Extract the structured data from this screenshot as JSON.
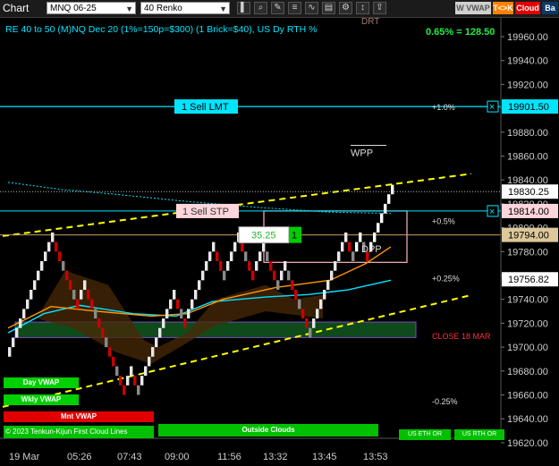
{
  "toolbar": {
    "title": "Chart",
    "instrument": "MNQ 06-25",
    "bar_type": "40 Renko",
    "buttons": [
      {
        "name": "bar-type-button",
        "glyph": "▌"
      },
      {
        "name": "zoom-button",
        "glyph": "⌕"
      },
      {
        "name": "drawing-button",
        "glyph": "✎"
      },
      {
        "name": "strategy-button",
        "glyph": "≡"
      },
      {
        "name": "indicator-button",
        "glyph": "∿"
      },
      {
        "name": "data-button",
        "glyph": "▤"
      },
      {
        "name": "settings-button",
        "glyph": "⚙"
      },
      {
        "name": "vertical-button",
        "glyph": "↕"
      },
      {
        "name": "share-button",
        "glyph": "⇪"
      }
    ],
    "wvwap_label": "W VWAP",
    "tk_label": "T<>K",
    "cloud_label": "Cloud",
    "extra_label": "Ba"
  },
  "header": {
    "info": "RE 40 to 50 (M)NQ Dec 20 (1%=150p=$300) (1 Brick=$40), US Dy RTH %",
    "perf": "0.65% = 128.50",
    "drt": "DRT"
  },
  "colors": {
    "bg": "#000000",
    "bull": "#ffffff",
    "bear": "#cc0000",
    "cyan": "#00e5ff",
    "orange": "#ff9900",
    "yellow": "#ffff00",
    "green": "#00cc00",
    "pink": "#ffb6c1"
  },
  "orders": {
    "sell_lmt": {
      "label": "1 Sell LMT",
      "price": "19901.50"
    },
    "sell_stp": {
      "label": "1 Sell STP",
      "price": "19814.00"
    },
    "position": {
      "pnl": "35.25",
      "qty": "1",
      "price": "19794.00"
    }
  },
  "levels": {
    "current_price": "19830.25",
    "vwap_price": "19756.82",
    "wpp": "WPP",
    "dpp": "DPP",
    "pct_labels": [
      {
        "text": "+1.0%",
        "price": 19901.5
      },
      {
        "text": "+0.5%",
        "price": 19806
      },
      {
        "text": "+0.25%",
        "price": 19758
      },
      {
        "text": "-0.25%",
        "price": 19655
      }
    ],
    "close_label": "CLOSE 18 MAR",
    "close_price": 19710
  },
  "chart_data": {
    "type": "renko",
    "brick_size": 8,
    "ylim": [
      19612,
      19980
    ],
    "y_ticks": [
      19620,
      19640,
      19660,
      19680,
      19700,
      19720,
      19740,
      19760,
      19780,
      19800,
      19820,
      19840,
      19860,
      19880,
      19900,
      19920,
      19940,
      19960
    ],
    "x_labels": [
      "19 Mar",
      "05:26",
      "07:43",
      "09:00",
      "11:56",
      "13:32",
      "13:45",
      "13:53"
    ],
    "bricks": [
      {
        "open": 19692,
        "dir": "up"
      },
      {
        "open": 19700,
        "dir": "up"
      },
      {
        "open": 19708,
        "dir": "up"
      },
      {
        "open": 19716,
        "dir": "up"
      },
      {
        "open": 19724,
        "dir": "up"
      },
      {
        "open": 19732,
        "dir": "up"
      },
      {
        "open": 19740,
        "dir": "up"
      },
      {
        "open": 19748,
        "dir": "up"
      },
      {
        "open": 19756,
        "dir": "up"
      },
      {
        "open": 19764,
        "dir": "up"
      },
      {
        "open": 19772,
        "dir": "up"
      },
      {
        "open": 19780,
        "dir": "up"
      },
      {
        "open": 19788,
        "dir": "up"
      },
      {
        "open": 19788,
        "dir": "down"
      },
      {
        "open": 19780,
        "dir": "down"
      },
      {
        "open": 19772,
        "dir": "down"
      },
      {
        "open": 19764,
        "dir": "down"
      },
      {
        "open": 19756,
        "dir": "down"
      },
      {
        "open": 19748,
        "dir": "down"
      },
      {
        "open": 19740,
        "dir": "down"
      },
      {
        "open": 19740,
        "dir": "up"
      },
      {
        "open": 19748,
        "dir": "up"
      },
      {
        "open": 19748,
        "dir": "down"
      },
      {
        "open": 19740,
        "dir": "down"
      },
      {
        "open": 19732,
        "dir": "down"
      },
      {
        "open": 19724,
        "dir": "down"
      },
      {
        "open": 19716,
        "dir": "down"
      },
      {
        "open": 19708,
        "dir": "down"
      },
      {
        "open": 19700,
        "dir": "down"
      },
      {
        "open": 19692,
        "dir": "down"
      },
      {
        "open": 19684,
        "dir": "down"
      },
      {
        "open": 19676,
        "dir": "down"
      },
      {
        "open": 19668,
        "dir": "down"
      },
      {
        "open": 19668,
        "dir": "up"
      },
      {
        "open": 19676,
        "dir": "up"
      },
      {
        "open": 19676,
        "dir": "down"
      },
      {
        "open": 19668,
        "dir": "down"
      },
      {
        "open": 19668,
        "dir": "up"
      },
      {
        "open": 19676,
        "dir": "up"
      },
      {
        "open": 19684,
        "dir": "up"
      },
      {
        "open": 19692,
        "dir": "up"
      },
      {
        "open": 19700,
        "dir": "up"
      },
      {
        "open": 19708,
        "dir": "up"
      },
      {
        "open": 19716,
        "dir": "up"
      },
      {
        "open": 19724,
        "dir": "up"
      },
      {
        "open": 19732,
        "dir": "up"
      },
      {
        "open": 19740,
        "dir": "up"
      },
      {
        "open": 19740,
        "dir": "down"
      },
      {
        "open": 19732,
        "dir": "down"
      },
      {
        "open": 19724,
        "dir": "down"
      },
      {
        "open": 19724,
        "dir": "up"
      },
      {
        "open": 19732,
        "dir": "up"
      },
      {
        "open": 19740,
        "dir": "up"
      },
      {
        "open": 19748,
        "dir": "up"
      },
      {
        "open": 19756,
        "dir": "up"
      },
      {
        "open": 19764,
        "dir": "up"
      },
      {
        "open": 19772,
        "dir": "up"
      },
      {
        "open": 19780,
        "dir": "up"
      },
      {
        "open": 19780,
        "dir": "down"
      },
      {
        "open": 19772,
        "dir": "down"
      },
      {
        "open": 19764,
        "dir": "down"
      },
      {
        "open": 19764,
        "dir": "up"
      },
      {
        "open": 19772,
        "dir": "up"
      },
      {
        "open": 19780,
        "dir": "up"
      },
      {
        "open": 19788,
        "dir": "up"
      },
      {
        "open": 19788,
        "dir": "down"
      },
      {
        "open": 19780,
        "dir": "down"
      },
      {
        "open": 19772,
        "dir": "down"
      },
      {
        "open": 19764,
        "dir": "down"
      },
      {
        "open": 19764,
        "dir": "up"
      },
      {
        "open": 19772,
        "dir": "up"
      },
      {
        "open": 19780,
        "dir": "up"
      },
      {
        "open": 19780,
        "dir": "down"
      },
      {
        "open": 19772,
        "dir": "down"
      },
      {
        "open": 19764,
        "dir": "down"
      },
      {
        "open": 19756,
        "dir": "down"
      },
      {
        "open": 19756,
        "dir": "up"
      },
      {
        "open": 19764,
        "dir": "up"
      },
      {
        "open": 19764,
        "dir": "down"
      },
      {
        "open": 19756,
        "dir": "down"
      },
      {
        "open": 19748,
        "dir": "down"
      },
      {
        "open": 19740,
        "dir": "down"
      },
      {
        "open": 19732,
        "dir": "down"
      },
      {
        "open": 19724,
        "dir": "down"
      },
      {
        "open": 19716,
        "dir": "down"
      },
      {
        "open": 19716,
        "dir": "up"
      },
      {
        "open": 19724,
        "dir": "up"
      },
      {
        "open": 19732,
        "dir": "up"
      },
      {
        "open": 19740,
        "dir": "up"
      },
      {
        "open": 19748,
        "dir": "up"
      },
      {
        "open": 19756,
        "dir": "up"
      },
      {
        "open": 19764,
        "dir": "up"
      },
      {
        "open": 19772,
        "dir": "up"
      },
      {
        "open": 19780,
        "dir": "up"
      },
      {
        "open": 19788,
        "dir": "up"
      },
      {
        "open": 19788,
        "dir": "down"
      },
      {
        "open": 19780,
        "dir": "down"
      },
      {
        "open": 19780,
        "dir": "up"
      },
      {
        "open": 19788,
        "dir": "up"
      },
      {
        "open": 19788,
        "dir": "down"
      },
      {
        "open": 19780,
        "dir": "down"
      },
      {
        "open": 19780,
        "dir": "up"
      },
      {
        "open": 19788,
        "dir": "up"
      },
      {
        "open": 19796,
        "dir": "up"
      },
      {
        "open": 19804,
        "dir": "up"
      },
      {
        "open": 19812,
        "dir": "up"
      },
      {
        "open": 19820,
        "dir": "up"
      },
      {
        "open": 19828,
        "dir": "up"
      }
    ],
    "series": [
      {
        "name": "VWAP",
        "color": "#00e5ff",
        "values": [
          [
            0,
            19712
          ],
          [
            10,
            19728
          ],
          [
            20,
            19735
          ],
          [
            35,
            19728
          ],
          [
            47,
            19726
          ],
          [
            57,
            19738
          ],
          [
            72,
            19742
          ],
          [
            84,
            19744
          ],
          [
            95,
            19748
          ],
          [
            107,
            19756
          ]
        ]
      },
      {
        "name": "Keltner",
        "color": "#ff9900",
        "values": [
          [
            0,
            19716
          ],
          [
            12,
            19734
          ],
          [
            25,
            19730
          ],
          [
            40,
            19726
          ],
          [
            50,
            19728
          ],
          [
            60,
            19740
          ],
          [
            75,
            19750
          ],
          [
            90,
            19756
          ],
          [
            100,
            19770
          ],
          [
            107,
            19784
          ]
        ]
      },
      {
        "name": "Weekly VWAP",
        "color": "#00e5ff",
        "values": [
          [
            0,
            19838
          ],
          [
            15,
            19832
          ],
          [
            30,
            19828
          ],
          [
            50,
            19822
          ],
          [
            70,
            19817
          ],
          [
            90,
            19813
          ],
          [
            107,
            19812
          ]
        ]
      }
    ],
    "trend_lines": [
      {
        "from": [
          0,
          19793
        ],
        "to": [
          107,
          19822
        ]
      },
      {
        "from": [
          0,
          19650
        ],
        "to": [
          107,
          19702
        ]
      }
    ],
    "zones": [
      {
        "label": "Green zone",
        "x": [
          0,
          107
        ],
        "y": [
          19708,
          19721
        ]
      }
    ],
    "box": {
      "x": [
        70,
        108
      ],
      "y": [
        19771,
        19814
      ]
    }
  },
  "footer": {
    "day_vwap": "Day VWAP",
    "wkly_vwap": "Wkly VWAP",
    "mnt_vwap": "Mnt VWAP",
    "legend": "© 2023 Tenkun-Kijun First Cloud Lines",
    "outside_clouds": "Outside Clouds",
    "us_eth": "US ETH OR",
    "us_rth": "US RTH OR"
  }
}
